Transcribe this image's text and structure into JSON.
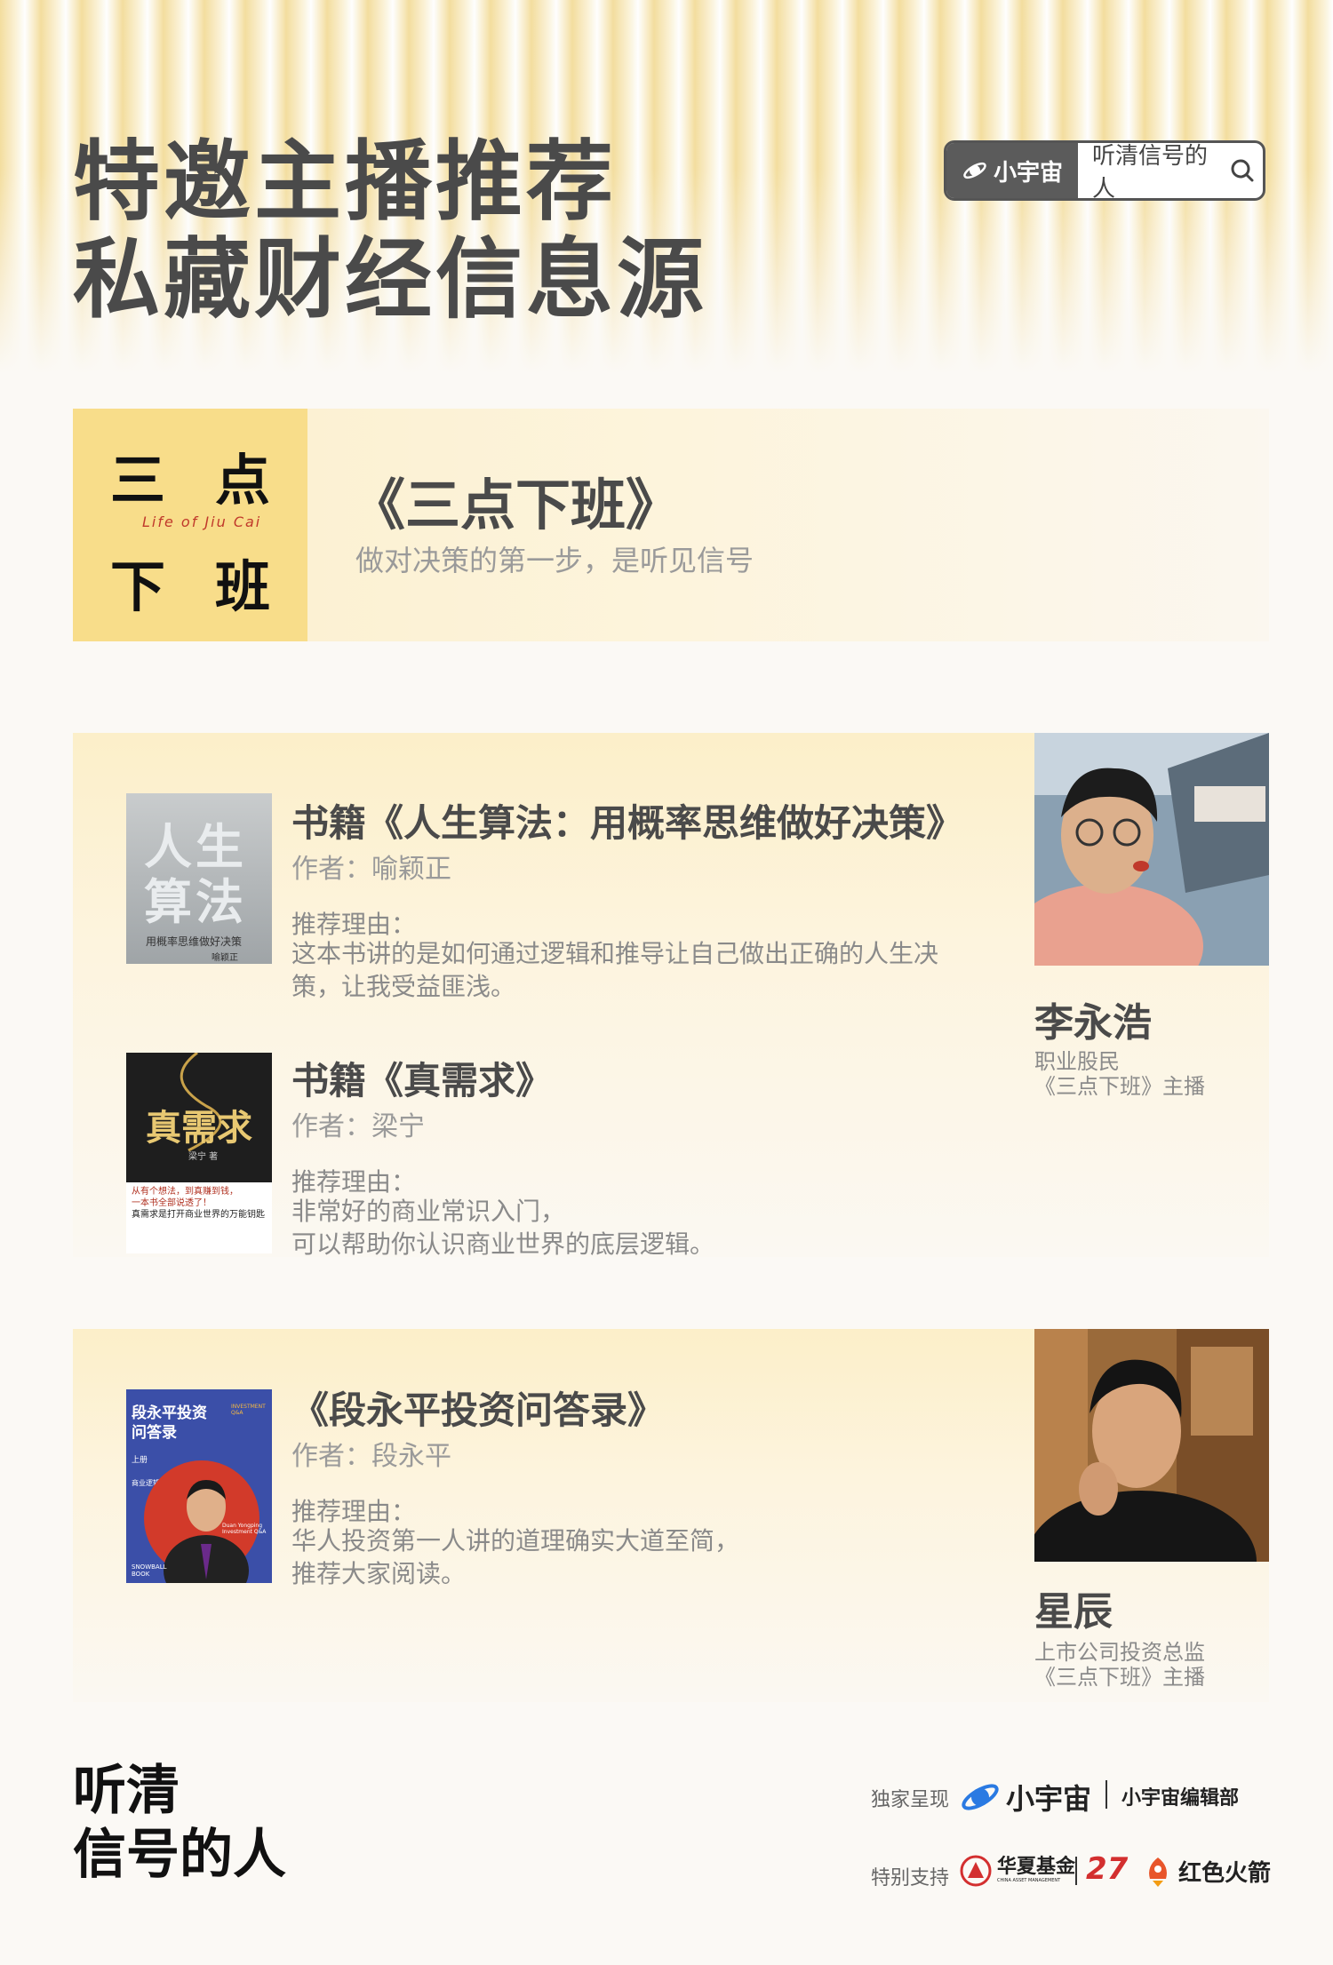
{
  "header": {
    "headline_line1": "特邀主播推荐",
    "headline_line2": "私藏财经信息源"
  },
  "search": {
    "brand": "小宇宙",
    "term": "听清信号的人",
    "icon": "search-icon"
  },
  "show": {
    "logo_char1": "三",
    "logo_char2": "点",
    "logo_char3": "下",
    "logo_char4": "班",
    "logo_subtitle": "Life of Jiu Cai",
    "title": "《三点下班》",
    "subtitle": "做对决策的第一步，是听见信号"
  },
  "hosts": [
    {
      "name": "李永浩",
      "role": "职业股民",
      "show_role": "《三点下班》主播",
      "books": [
        {
          "title": "书籍《人生算法：用概率思维做好决策》",
          "author": "作者：喻颖正",
          "reason_label": "推荐理由：",
          "reason": "这本书讲的是如何通过逻辑和推导让自己做出正确的人生决策，让我受益匪浅。",
          "cover_title_1": "人生",
          "cover_title_2": "算法",
          "cover_sub": "用概率思维做好决策",
          "cover_author": "喻颖正"
        },
        {
          "title": "书籍《真需求》",
          "author": "作者：梁宁",
          "reason_label": "推荐理由：",
          "reason_line1": "非常好的商业常识入门，",
          "reason_line2": "可以帮助你认识商业世界的底层逻辑。",
          "cover_title": "真需求",
          "cover_author": "梁宁 著",
          "cover_blurb1": "从有个想法，到真赚到钱，",
          "cover_blurb2": "一本书全部说透了！",
          "cover_blurb3": "真需求是打开商业世界的万能钥匙"
        }
      ]
    },
    {
      "name": "星辰",
      "role": "上市公司投资总监",
      "show_role": "《三点下班》主播",
      "books": [
        {
          "title": "《段永平投资问答录》",
          "author": "作者：段永平",
          "reason_label": "推荐理由：",
          "reason_line1": "华人投资第一人讲的道理确实大道至简，",
          "reason_line2": "推荐大家阅读。",
          "cover_title_1": "段永平投资",
          "cover_title_2": "问答录",
          "cover_tag": "INVESTMENT Q&A",
          "cover_vol": "上册",
          "cover_vol_sub": "商业逻辑篇",
          "cover_en": "Duan Yongping Investment Q&A",
          "cover_pub": "SNOWBALL BOOK"
        }
      ]
    }
  ],
  "footer": {
    "title_line1": "听清",
    "title_line2": "信号的人",
    "exclusive_label": "独家呈现",
    "exclusive_brand": "小宇宙",
    "exclusive_dept": "小宇宙编辑部",
    "support_label": "特别支持",
    "partner1": "华夏基金",
    "partner1_en": "CHINA ASSET MANAGEMENT",
    "partner2": "27",
    "partner3": "红色火箭"
  },
  "colors": {
    "accent_yellow": "#f8dd8a",
    "text_dark": "#4a4a4a",
    "text_muted": "#8a8a8a"
  }
}
